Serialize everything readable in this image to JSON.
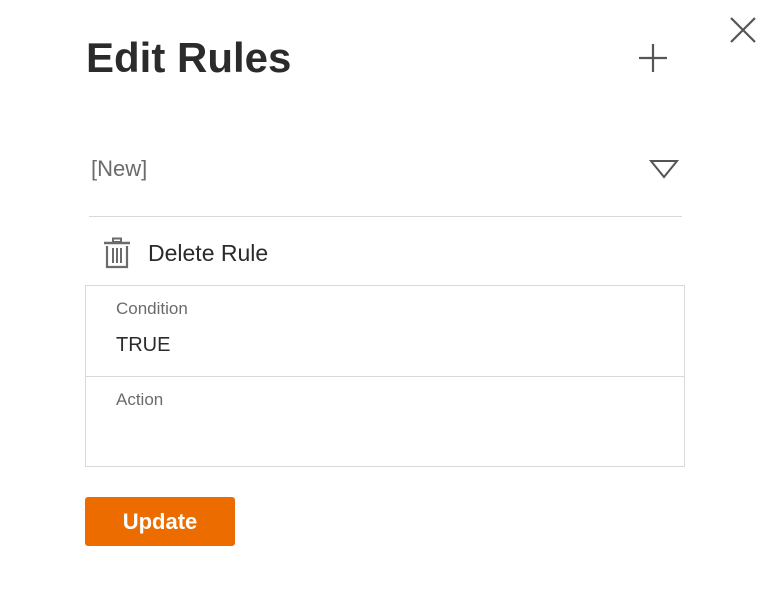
{
  "dialog": {
    "title": "Edit Rules",
    "close_icon": "close-icon",
    "add_icon": "plus-icon"
  },
  "rule_select": {
    "value": "[New]",
    "arrow_icon": "triangle-down-icon"
  },
  "delete_rule": {
    "label": "Delete Rule",
    "icon": "trash-icon"
  },
  "fields": {
    "condition": {
      "label": "Condition",
      "value": "TRUE"
    },
    "action": {
      "label": "Action",
      "value": ""
    }
  },
  "update_button": {
    "label": "Update"
  },
  "colors": {
    "accent": "#ec6c00",
    "text": "#2b2b2b",
    "muted_text": "#6b6b6b",
    "border": "#d9d9d9"
  }
}
